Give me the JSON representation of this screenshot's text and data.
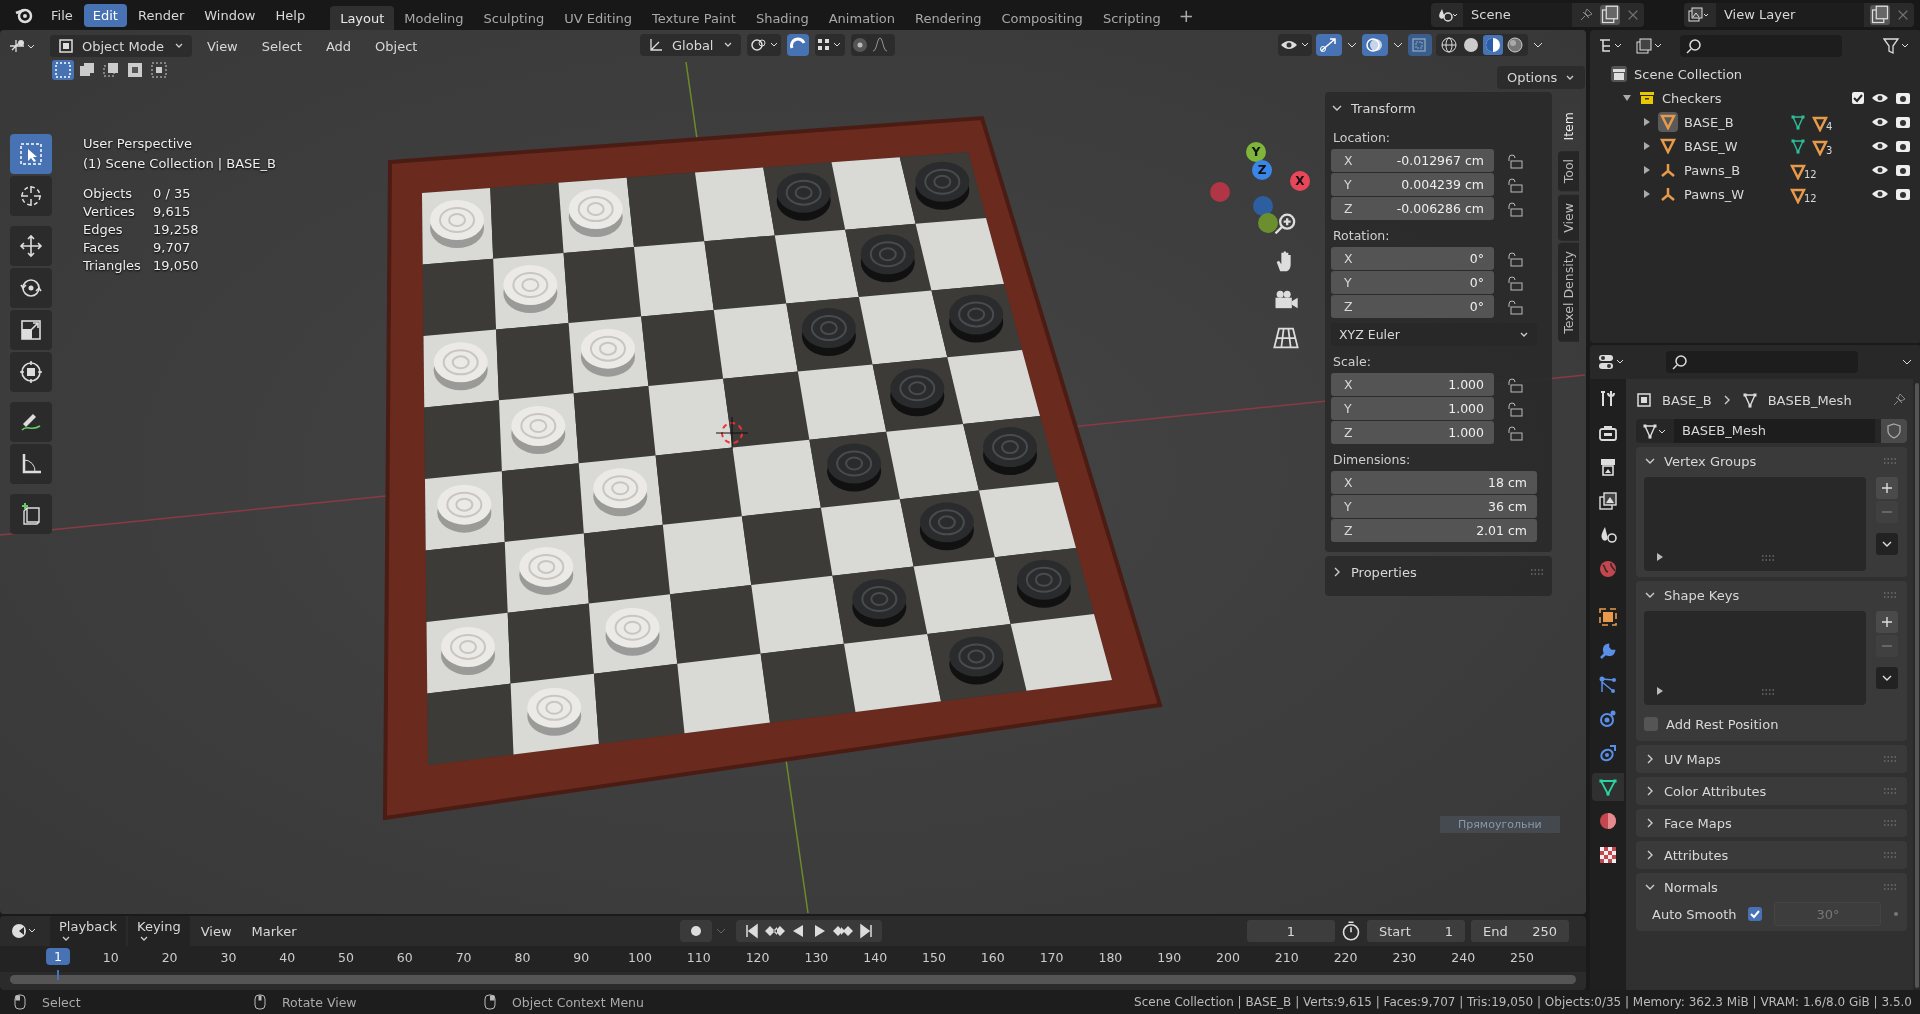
{
  "menu": [
    {
      "label": "File",
      "selected": false
    },
    {
      "label": "Edit",
      "selected": true
    },
    {
      "label": "Render",
      "selected": false
    },
    {
      "label": "Window",
      "selected": false
    },
    {
      "label": "Help",
      "selected": false
    }
  ],
  "workspaces": [
    {
      "label": "Layout",
      "selected": true
    },
    {
      "label": "Modeling",
      "selected": false
    },
    {
      "label": "Sculpting",
      "selected": false
    },
    {
      "label": "UV Editing",
      "selected": false
    },
    {
      "label": "Texture Paint",
      "selected": false
    },
    {
      "label": "Shading",
      "selected": false
    },
    {
      "label": "Animation",
      "selected": false
    },
    {
      "label": "Rendering",
      "selected": false
    },
    {
      "label": "Compositing",
      "selected": false
    },
    {
      "label": "Scripting",
      "selected": false
    }
  ],
  "add_workspace": "+",
  "scene": "Scene",
  "view_layer": "View Layer",
  "viewport_header": {
    "mode": "Object Mode",
    "menus": [
      "View",
      "Select",
      "Add",
      "Object"
    ],
    "orientation": "Global",
    "options": "Options"
  },
  "tools": [
    {
      "kind": "select",
      "selected": true
    },
    {
      "kind": "cursor",
      "selected": false
    },
    {
      "kind": "move",
      "selected": false
    },
    {
      "kind": "rotate",
      "selected": false
    },
    {
      "kind": "scale",
      "selected": false
    },
    {
      "kind": "transform",
      "selected": false
    },
    {
      "kind": "annotate",
      "selected": false
    },
    {
      "kind": "measure",
      "selected": false
    },
    {
      "kind": "add-cube",
      "selected": false
    }
  ],
  "overlay": {
    "title": "User Perspective",
    "collection": "(1) Scene Collection | BASE_B",
    "stats": [
      {
        "label": "Objects",
        "value": "0 / 35"
      },
      {
        "label": "Vertices",
        "value": "9,615"
      },
      {
        "label": "Edges",
        "value": "19,258"
      },
      {
        "label": "Faces",
        "value": "9,707"
      },
      {
        "label": "Triangles",
        "value": "19,050"
      }
    ]
  },
  "gizmo": [
    {
      "label": "Y",
      "color": "#7fb53a"
    },
    {
      "label": "Z",
      "color": "#3a86e8"
    },
    {
      "label": "X",
      "color": "#e8475a"
    }
  ],
  "n_panel": {
    "tabs": [
      {
        "label": "Item",
        "selected": true
      },
      {
        "label": "Tool",
        "selected": false
      },
      {
        "label": "View",
        "selected": false
      },
      {
        "label": "Texel Density",
        "selected": false
      }
    ],
    "transform": {
      "title": "Transform",
      "expanded": true,
      "groups": [
        {
          "label": "Location:",
          "locked": false,
          "fields": [
            {
              "axis": "X",
              "value": "-0.012967 cm"
            },
            {
              "axis": "Y",
              "value": "0.004239 cm"
            },
            {
              "axis": "Z",
              "value": "-0.006286 cm"
            }
          ]
        },
        {
          "label": "Rotation:",
          "locked": false,
          "fields": [
            {
              "axis": "X",
              "value": "0°"
            },
            {
              "axis": "Y",
              "value": "0°"
            },
            {
              "axis": "Z",
              "value": "0°"
            }
          ],
          "mode": "XYZ Euler"
        },
        {
          "label": "Scale:",
          "locked": false,
          "fields": [
            {
              "axis": "X",
              "value": "1.000"
            },
            {
              "axis": "Y",
              "value": "1.000"
            },
            {
              "axis": "Z",
              "value": "1.000"
            }
          ]
        },
        {
          "label": "Dimensions:",
          "fields": [
            {
              "axis": "X",
              "value": "18 cm"
            },
            {
              "axis": "Y",
              "value": "36 cm"
            },
            {
              "axis": "Z",
              "value": "2.01 cm"
            }
          ]
        }
      ]
    },
    "properties": {
      "title": "Properties",
      "expanded": false
    }
  },
  "outliner": {
    "root": "Scene Collection",
    "items": [
      {
        "name": "Checkers",
        "kind": "collection",
        "expanded": true,
        "checked": true,
        "children": [
          {
            "name": "BASE_B",
            "kind": "mesh",
            "selected": true,
            "badges": [
              {
                "kind": "mesh-data"
              },
              {
                "kind": "object",
                "count": "4"
              }
            ]
          },
          {
            "name": "BASE_W",
            "kind": "mesh",
            "selected": false,
            "badges": [
              {
                "kind": "mesh-data"
              },
              {
                "kind": "object",
                "count": "3"
              }
            ]
          },
          {
            "name": "Pawns_B",
            "kind": "empty",
            "selected": false,
            "badges": [
              {
                "kind": "object",
                "count": "12"
              }
            ]
          },
          {
            "name": "Pawns_W",
            "kind": "empty",
            "selected": false,
            "badges": [
              {
                "kind": "object",
                "count": "12"
              }
            ]
          }
        ]
      }
    ]
  },
  "properties": {
    "tabs": [
      {
        "kind": "tool",
        "selected": false
      },
      {
        "kind": "render",
        "selected": false
      },
      {
        "kind": "output",
        "selected": false
      },
      {
        "kind": "view-layer",
        "selected": false
      },
      {
        "kind": "scene",
        "selected": false
      },
      {
        "kind": "world",
        "selected": false
      },
      {
        "kind": "object",
        "selected": false
      },
      {
        "kind": "modifiers",
        "selected": false
      },
      {
        "kind": "particles",
        "selected": false
      },
      {
        "kind": "physics",
        "selected": false
      },
      {
        "kind": "constraints",
        "selected": false
      },
      {
        "kind": "data",
        "selected": true
      },
      {
        "kind": "material",
        "selected": false
      },
      {
        "kind": "texture",
        "selected": false
      }
    ],
    "breadcrumb": [
      "BASE_B",
      "BASEB_Mesh"
    ],
    "mesh_name": "BASEB_Mesh",
    "panels": [
      {
        "title": "Vertex Groups",
        "kind": "list",
        "expanded": true
      },
      {
        "title": "Shape Keys",
        "kind": "list",
        "expanded": true,
        "checkbox": {
          "label": "Add Rest Position",
          "checked": false
        }
      },
      {
        "title": "UV Maps",
        "kind": "plain",
        "expanded": false
      },
      {
        "title": "Color Attributes",
        "kind": "plain",
        "expanded": false
      },
      {
        "title": "Face Maps",
        "kind": "plain",
        "expanded": false
      },
      {
        "title": "Attributes",
        "kind": "plain",
        "expanded": false
      },
      {
        "title": "Normals",
        "kind": "normals",
        "expanded": true,
        "option": {
          "label": "Auto Smooth",
          "checked": true,
          "value": "30°",
          "disabled": true
        }
      }
    ]
  },
  "tooltip": "Прямоугольни",
  "timeline": {
    "menus": [
      "Playback",
      "Keying",
      "View",
      "Marker"
    ],
    "current_frame": "1",
    "start": {
      "label": "Start",
      "value": "1"
    },
    "end": {
      "label": "End",
      "value": "250"
    },
    "frames": [
      {
        "label": "1",
        "selected": true
      },
      {
        "label": "10",
        "selected": false
      },
      {
        "label": "20",
        "selected": false
      },
      {
        "label": "30",
        "selected": false
      },
      {
        "label": "40",
        "selected": false
      },
      {
        "label": "50",
        "selected": false
      },
      {
        "label": "60",
        "selected": false
      },
      {
        "label": "70",
        "selected": false
      },
      {
        "label": "80",
        "selected": false
      },
      {
        "label": "90",
        "selected": false
      },
      {
        "label": "100",
        "selected": false
      },
      {
        "label": "110",
        "selected": false
      },
      {
        "label": "120",
        "selected": false
      },
      {
        "label": "130",
        "selected": false
      },
      {
        "label": "140",
        "selected": false
      },
      {
        "label": "150",
        "selected": false
      },
      {
        "label": "160",
        "selected": false
      },
      {
        "label": "170",
        "selected": false
      },
      {
        "label": "180",
        "selected": false
      },
      {
        "label": "190",
        "selected": false
      },
      {
        "label": "200",
        "selected": false
      },
      {
        "label": "210",
        "selected": false
      },
      {
        "label": "220",
        "selected": false
      },
      {
        "label": "230",
        "selected": false
      },
      {
        "label": "240",
        "selected": false
      },
      {
        "label": "250",
        "selected": false
      }
    ]
  },
  "status_bar": {
    "hints": [
      "Select",
      "Rotate View",
      "Object Context Menu"
    ],
    "info": "Scene Collection | BASE_B | Verts:9,615 | Faces:9,707 | Tris:19,050 | Objects:0/35 | Memory: 362.3 MiB | VRAM: 1.6/8.0 GiB | 3.5.0"
  }
}
